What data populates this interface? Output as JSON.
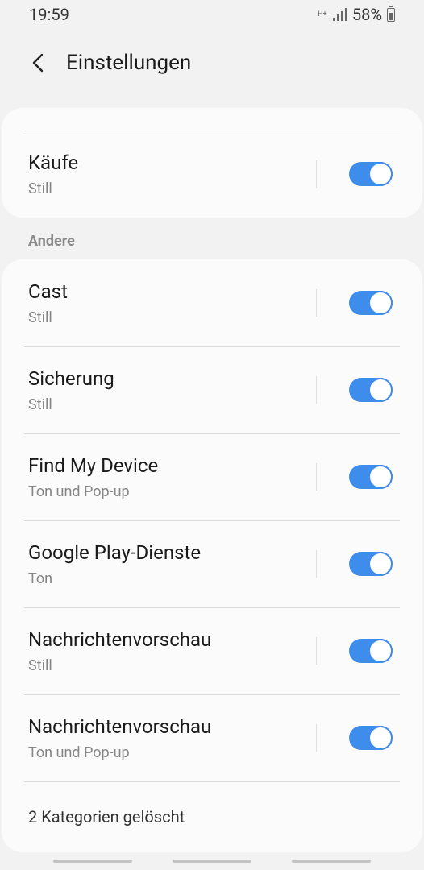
{
  "status_bar": {
    "time": "19:59",
    "network": "H+",
    "battery_percent": "58%",
    "battery_level": 0.58
  },
  "app_bar": {
    "title": "Einstellungen",
    "back_icon": "chevron-left-icon"
  },
  "top_card": {
    "item": {
      "title": "Käufe",
      "subtitle": "Still",
      "enabled": true
    }
  },
  "section": {
    "header": "Andere"
  },
  "items": [
    {
      "title": "Cast",
      "subtitle": "Still",
      "enabled": true
    },
    {
      "title": "Sicherung",
      "subtitle": "Still",
      "enabled": true
    },
    {
      "title": "Find My Device",
      "subtitle": "Ton und Pop-up",
      "enabled": true
    },
    {
      "title": "Google Play-Dienste",
      "subtitle": "Ton",
      "enabled": true
    },
    {
      "title": "Nachrichtenvorschau",
      "subtitle": "Still",
      "enabled": true
    },
    {
      "title": "Nachrichtenvorschau",
      "subtitle": "Ton und Pop-up",
      "enabled": true
    }
  ],
  "footer": {
    "deleted_categories": "2 Kategorien gelöscht"
  },
  "colors": {
    "accent": "#3e8ded",
    "background": "#f2f2f2",
    "card": "#fbfbfb"
  }
}
